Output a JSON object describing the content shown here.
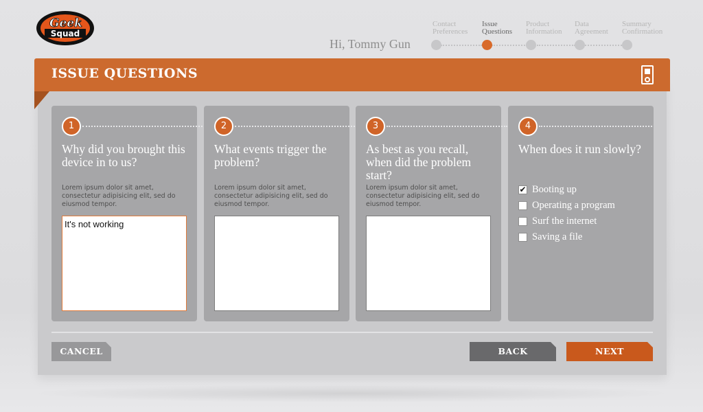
{
  "brand": {
    "logo_line1": "Geek",
    "logo_line2": "Squad",
    "accent": "#cc6a2e",
    "dark_accent": "#c9591c"
  },
  "greeting": "Hi, Tommy Gun",
  "progress": {
    "current_index": 1,
    "steps": [
      {
        "line1": "Contact",
        "line2": "Preferences"
      },
      {
        "line1": "Issue",
        "line2": "Questions"
      },
      {
        "line1": "Product",
        "line2": "Information"
      },
      {
        "line1": "Data",
        "line2": "Agreement"
      },
      {
        "line1": "Summary",
        "line2": "Confirmation"
      }
    ]
  },
  "header": {
    "title": "ISSUE QUESTIONS",
    "icon": "media-player-icon"
  },
  "questions": [
    {
      "number": "1",
      "title": "Why did you brought this device in to us?",
      "description": "Lorem ipsum dolor sit amet, consectetur adipisicing elit, sed do eiusmod tempor.",
      "answer": "It's not working"
    },
    {
      "number": "2",
      "title": "What events trigger the problem?",
      "description": "Lorem ipsum dolor sit amet, consectetur adipisicing elit, sed do eiusmod tempor.",
      "answer": ""
    },
    {
      "number": "3",
      "title": "As best as you recall, when did the problem start?",
      "description": "Lorem ipsum dolor sit amet, consectetur adipisicing elit, sed do eiusmod tempor.",
      "answer": ""
    },
    {
      "number": "4",
      "title": "When does it run slowly?",
      "options": [
        {
          "label": "Booting up",
          "checked": true
        },
        {
          "label": "Operating a program",
          "checked": false
        },
        {
          "label": "Surf the internet",
          "checked": false
        },
        {
          "label": "Saving a file",
          "checked": false
        }
      ]
    }
  ],
  "buttons": {
    "cancel": "CANCEL",
    "back": "BACK",
    "next": "NEXT"
  }
}
